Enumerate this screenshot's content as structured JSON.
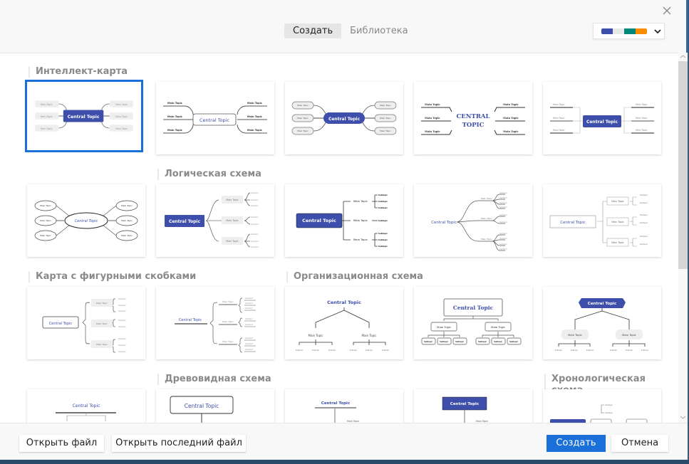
{
  "header": {
    "tabs": [
      {
        "label": "Создать",
        "active": true
      },
      {
        "label": "Библиотека",
        "active": false
      }
    ],
    "theme_swatches": [
      "#3d4eab",
      "#e8e8e8",
      "#00897b",
      "#fb8c00"
    ]
  },
  "sections": [
    {
      "title": "Интеллект-карта"
    },
    {
      "title": "Логическая схема"
    },
    {
      "title": "Карта с фигурными скобками"
    },
    {
      "title": "Организационная схема"
    },
    {
      "title": "Древовидная схема"
    },
    {
      "title": "Хронологическая схема"
    }
  ],
  "labels": {
    "central": "Central Topic",
    "central_caps_1": "CENTRAL",
    "central_caps_2": "TOPIC",
    "main": "Main Topic",
    "sub": "Subtopic"
  },
  "footer": {
    "open_file": "Открыть файл",
    "open_recent": "Открыть последний файл",
    "create": "Создать",
    "cancel": "Отмена"
  },
  "colors": {
    "accent": "#1a6fd8",
    "topic_blue": "#3d4eab"
  }
}
